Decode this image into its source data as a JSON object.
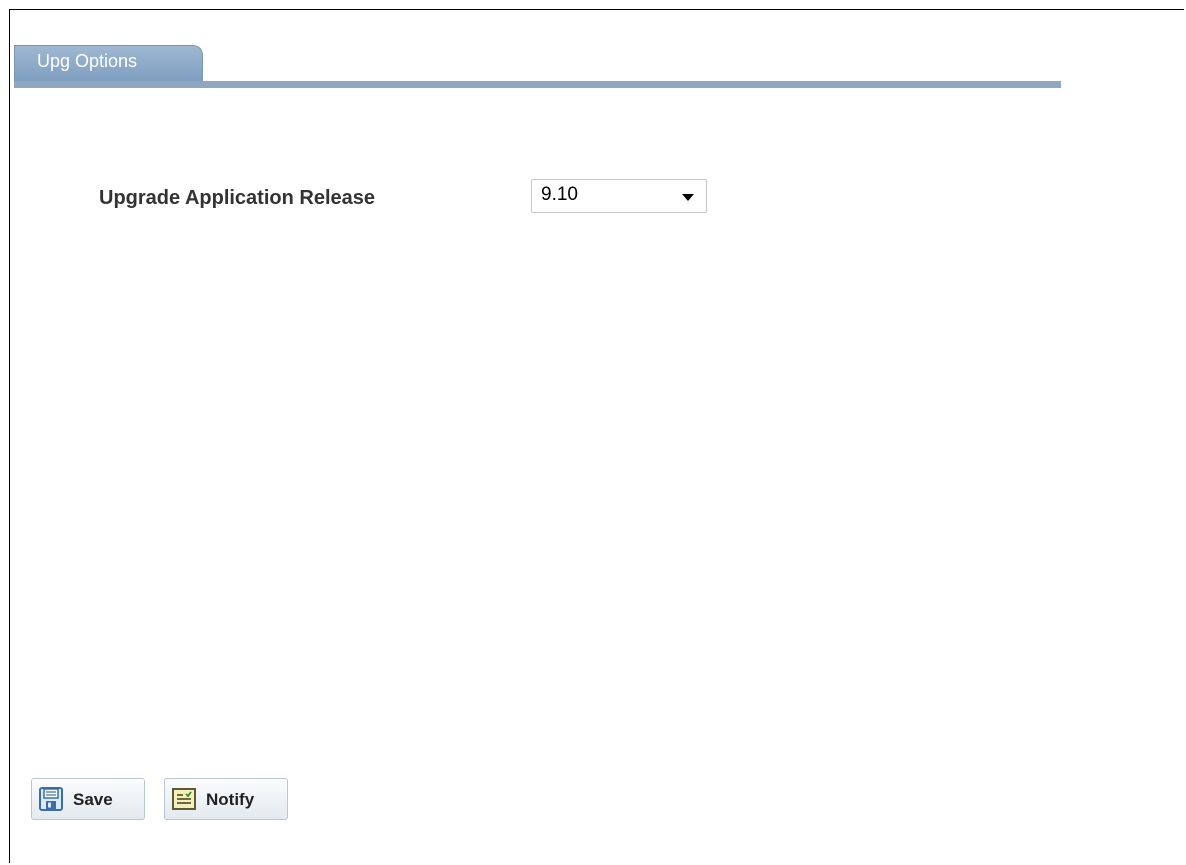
{
  "tabs": [
    {
      "label": "Upg Options",
      "active": true
    }
  ],
  "form": {
    "release_label": "Upgrade Application Release",
    "release_value": "9.10"
  },
  "actions": {
    "save_label": "Save",
    "notify_label": "Notify"
  },
  "icons": {
    "save": "floppy-disk-icon",
    "notify": "note-icon",
    "dropdown": "chevron-down-icon"
  },
  "colors": {
    "tab_fill": "#8ea6c2",
    "tab_text": "#ffffff",
    "label_text": "#333333"
  }
}
